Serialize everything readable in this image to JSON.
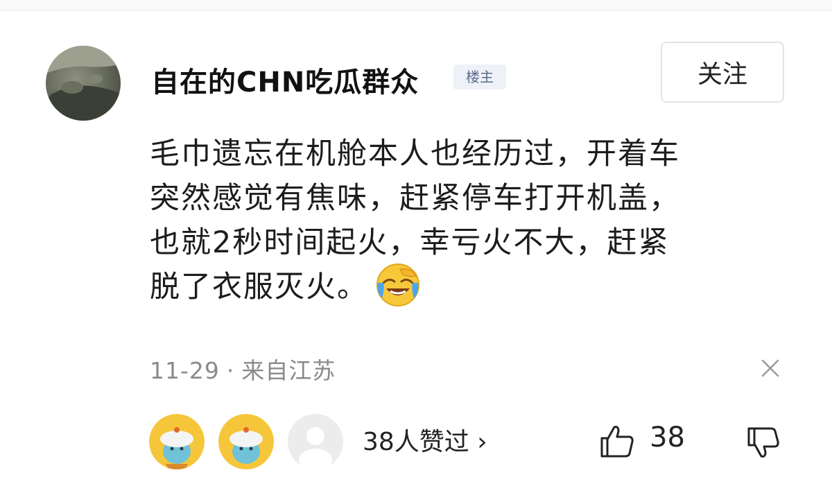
{
  "comment": {
    "username": "自在的CHN吃瓜群众",
    "badge": "楼主",
    "follow_label": "关注",
    "content_lines": [
      "毛巾遗忘在机舱本人也经历过，开着车",
      "突然感觉有焦味，赶紧停车打开机盖，",
      "也就2秒时间起火，幸亏火不大，赶紧",
      "脱了衣服灭火。"
    ],
    "emoji": "laughing-crying-emoji",
    "date": "11-29",
    "separator": "·",
    "location": "来自江苏",
    "likers_label": "38人赞过",
    "likers_chevron": "›",
    "like_count": "38"
  },
  "icons": {
    "close": "close-icon",
    "like": "thumbs-up-icon",
    "dislike": "thumbs-down-icon"
  },
  "colors": {
    "badge_bg": "#eef1f8",
    "badge_text": "#5b6b8c",
    "meta_text": "#8a8a8a",
    "emoji_face": "#f7c83a",
    "liker_bg": "#f6c63a"
  }
}
